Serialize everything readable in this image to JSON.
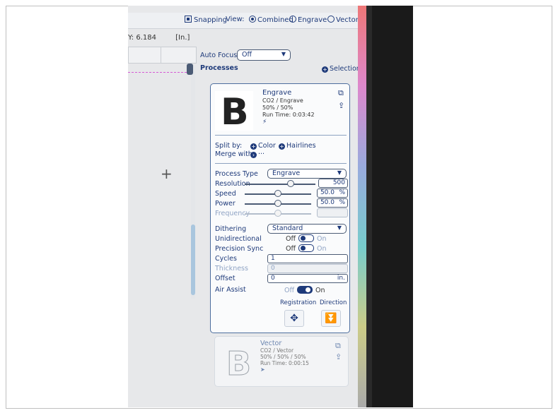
{
  "toolbar": {
    "snapping_label": "Snapping",
    "view_label": "View:",
    "view_options": [
      "Combined",
      "Engrave",
      "Vector"
    ],
    "view_selected": "Combined"
  },
  "coords": {
    "y_label": "Y: 6.184",
    "unit_label": "[In.]"
  },
  "auto_focus": {
    "label": "Auto Focus",
    "value": "Off"
  },
  "processes": {
    "title": "Processes",
    "selection_label": "Selection",
    "engrave": {
      "name": "Engrave",
      "subtitle": "CO2 / Engrave",
      "power_speed": "50% / 50%",
      "run_time": "Run Time: 0:03:42"
    },
    "split_by_label": "Split by:",
    "split_options": [
      "Color",
      "Hairlines"
    ],
    "merge_with_label": "Merge with:",
    "merge_value": "···",
    "settings": {
      "process_type_label": "Process Type",
      "process_type_value": "Engrave",
      "resolution_label": "Resolution",
      "resolution_value": "500",
      "speed_label": "Speed",
      "speed_value": "50.0",
      "speed_unit": "%",
      "power_label": "Power",
      "power_value": "50.0",
      "power_unit": "%",
      "frequency_label": "Frequency",
      "dithering_label": "Dithering",
      "dithering_value": "Standard",
      "unidirectional_label": "Unidirectional",
      "precision_sync_label": "Precision Sync",
      "off_label": "Off",
      "on_label": "On",
      "cycles_label": "Cycles",
      "cycles_value": "1",
      "thickness_label": "Thickness",
      "thickness_value": "0",
      "offset_label": "Offset",
      "offset_value": "0",
      "offset_unit": "in.",
      "air_assist_label": "Air Assist",
      "registration_label": "Registration",
      "direction_label": "Direction"
    },
    "vector": {
      "name": "Vector",
      "subtitle": "CO2 / Vector",
      "power_speed": "50% / 50% / 50%",
      "run_time": "Run Time: 0:00:15"
    }
  }
}
